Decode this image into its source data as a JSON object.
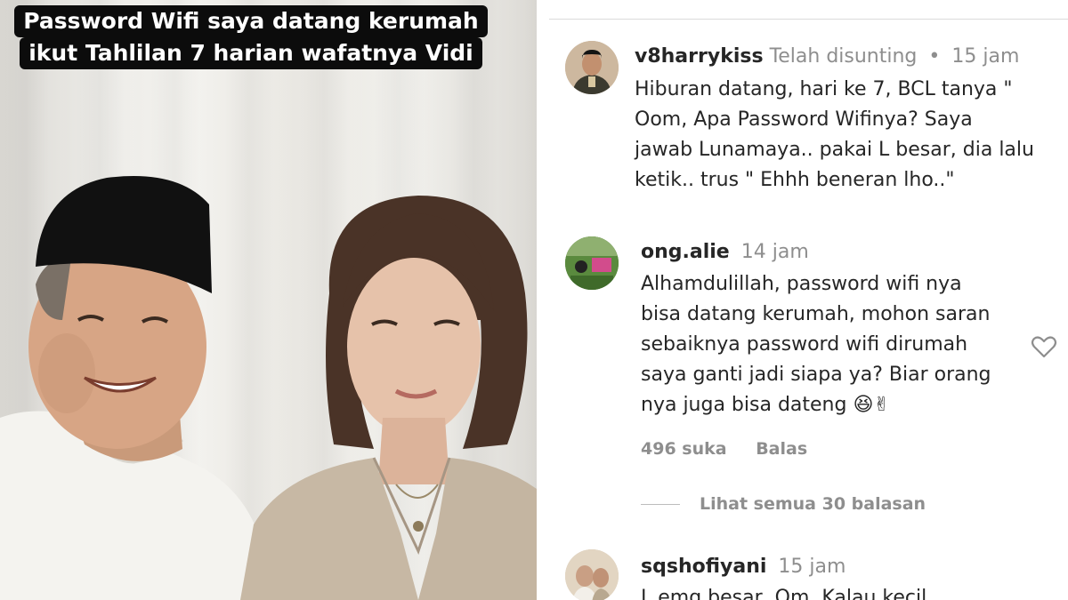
{
  "caption": {
    "line1": "Password Wifi saya datang kerumah",
    "line2": "ikut Tahlilan 7 harian wafatnya Vidi"
  },
  "comments": [
    {
      "username": "v8harrykiss",
      "edited": "Telah disunting",
      "separator": "•",
      "time": "15 jam",
      "text": "Hiburan datang, hari ke 7, BCL tanya \"\nOom, Apa Password Wifinya? Saya\njawab Lunamaya.. pakai L besar, dia lalu\nketik.. trus \" Ehhh beneran lho..\""
    },
    {
      "username": "ong.alie",
      "time": "14 jam",
      "text": "Alhamdulillah, password wifi nya\nbisa datang kerumah, mohon saran\nsebaiknya password wifi dirumah\nsaya ganti jadi siapa ya? Biar orang\nnya juga bisa dateng 😆✌",
      "likes": "496 suka",
      "reply_label": "Balas",
      "like_icon": "heart-outline-icon"
    },
    {
      "username": "sqshofiyani",
      "time": "15 jam",
      "text": "L emg besar, Om. Kalau kecil"
    }
  ],
  "view_replies": "Lihat semua 30 balasan",
  "colors": {
    "username": "#262626",
    "meta": "#8e8e8e",
    "caption_bg": "#0c0c0c",
    "divider": "#dbdbdb"
  }
}
